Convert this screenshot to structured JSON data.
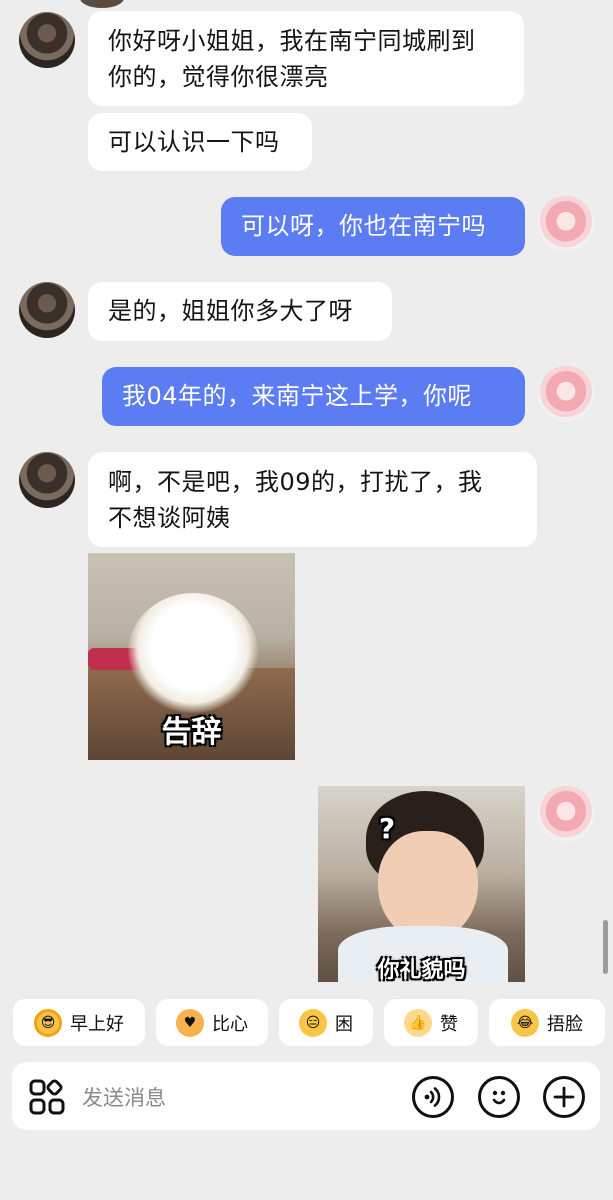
{
  "messages": [
    {
      "direction": "incoming",
      "lines": [
        "你好呀小姐姐，我在南宁同城刷到",
        "你的，觉得你很漂亮"
      ]
    },
    {
      "direction": "incoming",
      "lines": [
        "可以认识一下吗"
      ]
    },
    {
      "direction": "outgoing",
      "lines": [
        "可以呀，你也在南宁吗"
      ]
    },
    {
      "direction": "incoming",
      "lines": [
        "是的，姐姐你多大了呀"
      ]
    },
    {
      "direction": "outgoing",
      "lines": [
        "我04年的，来南宁这上学，你呢"
      ]
    },
    {
      "direction": "incoming",
      "lines": [
        "啊，不是吧，我09的，打扰了，我",
        "不想谈阿姨"
      ]
    }
  ],
  "stickers": {
    "farewell": {
      "caption": "告辞"
    },
    "puzzled": {
      "caption": "你礼貌吗",
      "mark": "?"
    }
  },
  "quick_replies": [
    {
      "label": "早上好",
      "icon": "sun-face-icon"
    },
    {
      "label": "比心",
      "icon": "heart-hands-icon"
    },
    {
      "label": "困",
      "icon": "sleepy-face-icon"
    },
    {
      "label": "赞",
      "icon": "thumbs-up-icon"
    },
    {
      "label": "捂脸",
      "icon": "facepalm-icon"
    }
  ],
  "input": {
    "placeholder": "发送消息"
  },
  "colors": {
    "background": "#ededed",
    "outgoing_bubble": "#5b7cf2",
    "incoming_bubble": "#ffffff"
  }
}
